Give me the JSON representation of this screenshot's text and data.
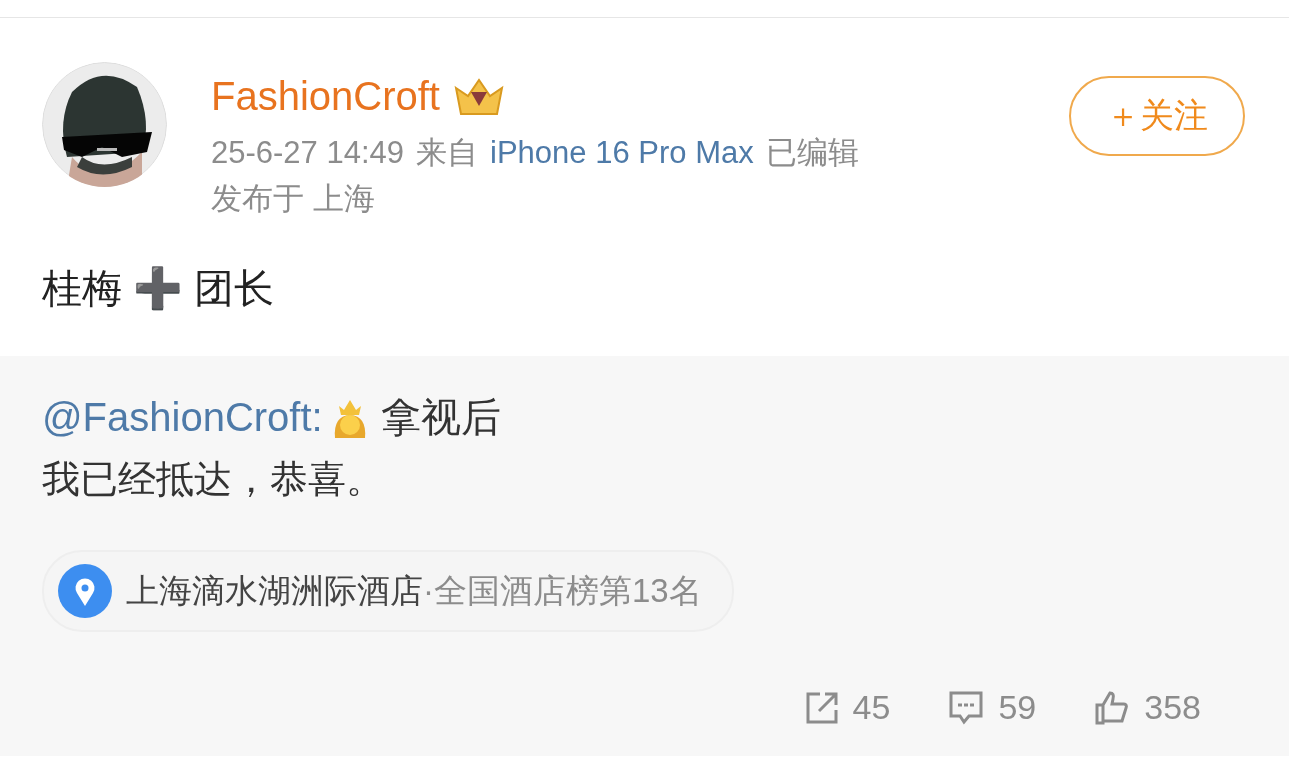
{
  "post": {
    "author": "FashionCroft",
    "time": "25-6-27 14:49",
    "source_prefix": "来自",
    "source": "iPhone 16 Pro Max",
    "edited": "已编辑",
    "location": "发布于 上海",
    "follow_button": "＋关注",
    "text": "桂梅 ➕ 团长"
  },
  "repost": {
    "author": "@FashionCroft:",
    "line_1": "拿视后",
    "line_2": "我已经抵达，恭喜。",
    "place": {
      "name": "上海滴水湖洲际酒店",
      "rank": "·全国酒店榜第13名"
    }
  },
  "actions": [
    {
      "kind": "share",
      "count": "45"
    },
    {
      "kind": "comment",
      "count": "59"
    },
    {
      "kind": "like",
      "count": "358"
    }
  ]
}
